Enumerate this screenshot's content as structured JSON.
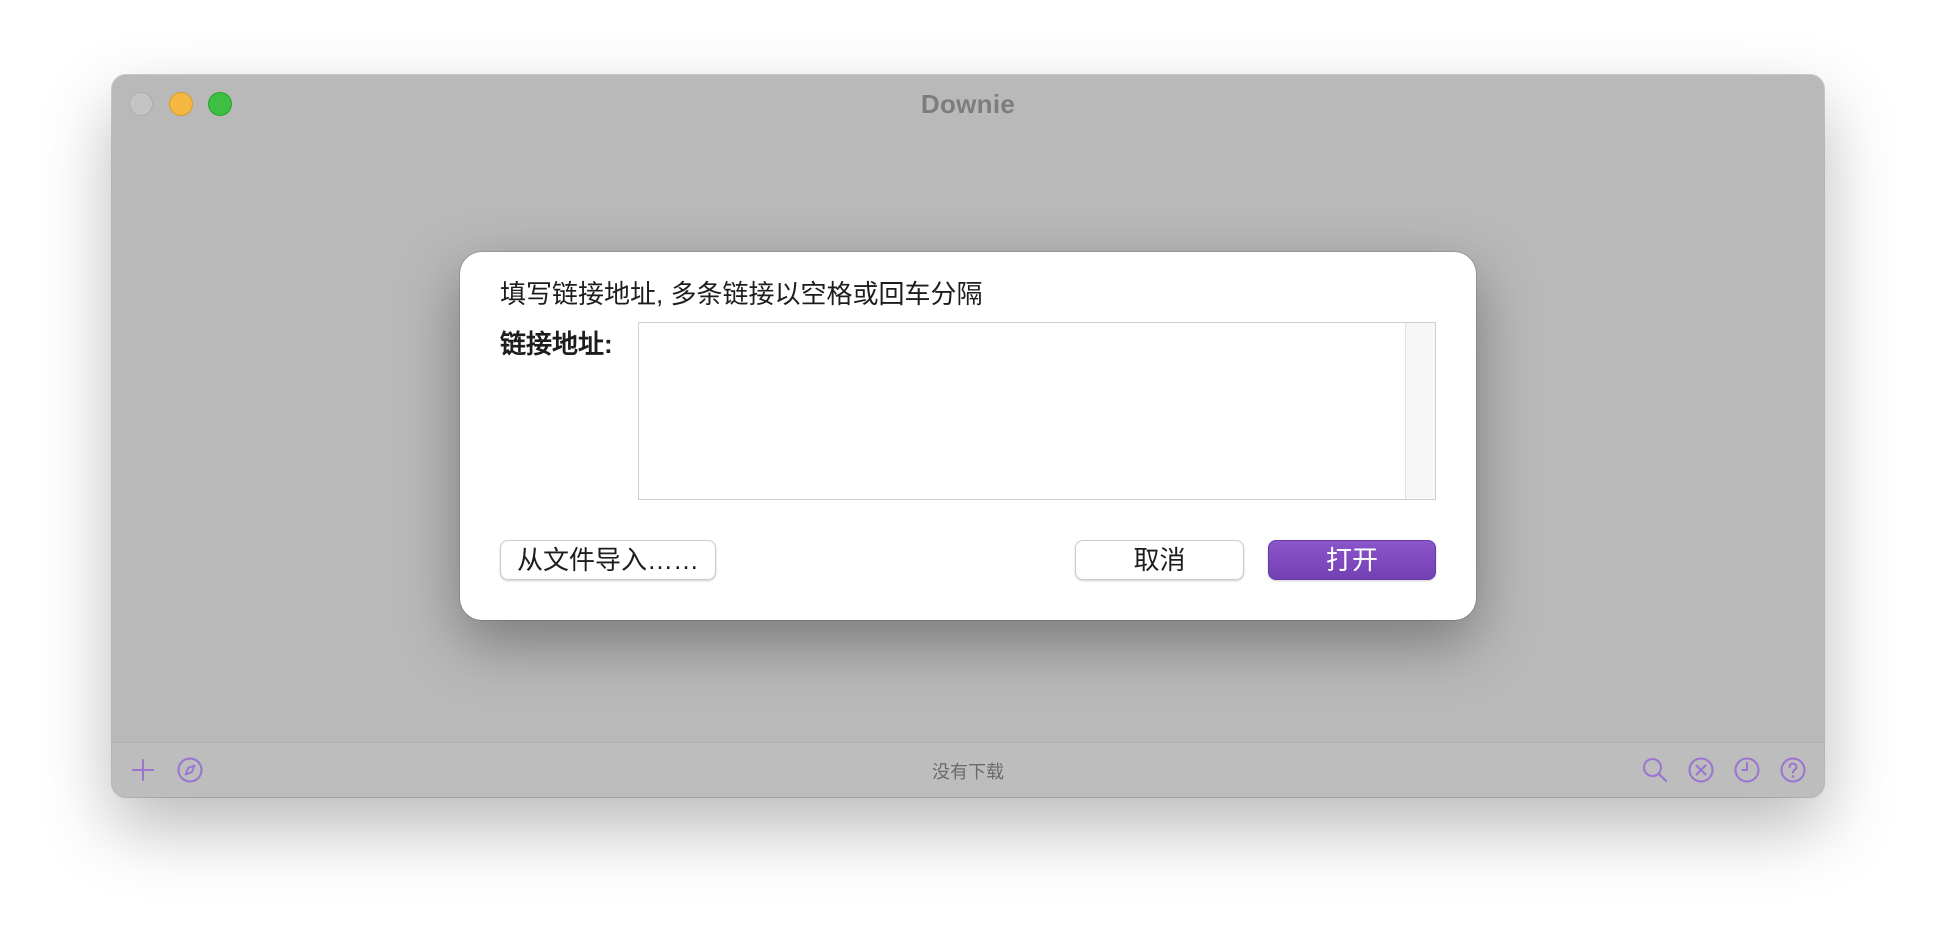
{
  "window": {
    "title": "Downie"
  },
  "dialog": {
    "instruction": "填写链接地址, 多条链接以空格或回车分隔",
    "url_label": "链接地址:",
    "url_value": "",
    "import_button": "从文件导入……",
    "cancel_button": "取消",
    "open_button": "打开"
  },
  "statusbar": {
    "status_text": "没有下载",
    "left_icons": [
      "plus-icon",
      "compass-icon"
    ],
    "right_icons": [
      "search-icon",
      "close-circle-icon",
      "clock-icon",
      "help-icon"
    ]
  },
  "colors": {
    "accent": "#7b46bb",
    "icon_tint": "#9a74d0",
    "window_bg": "#b9b9b9",
    "close_light": "#c4c4c4",
    "minimize_light": "#f5b740",
    "zoom_light": "#3fc043"
  }
}
